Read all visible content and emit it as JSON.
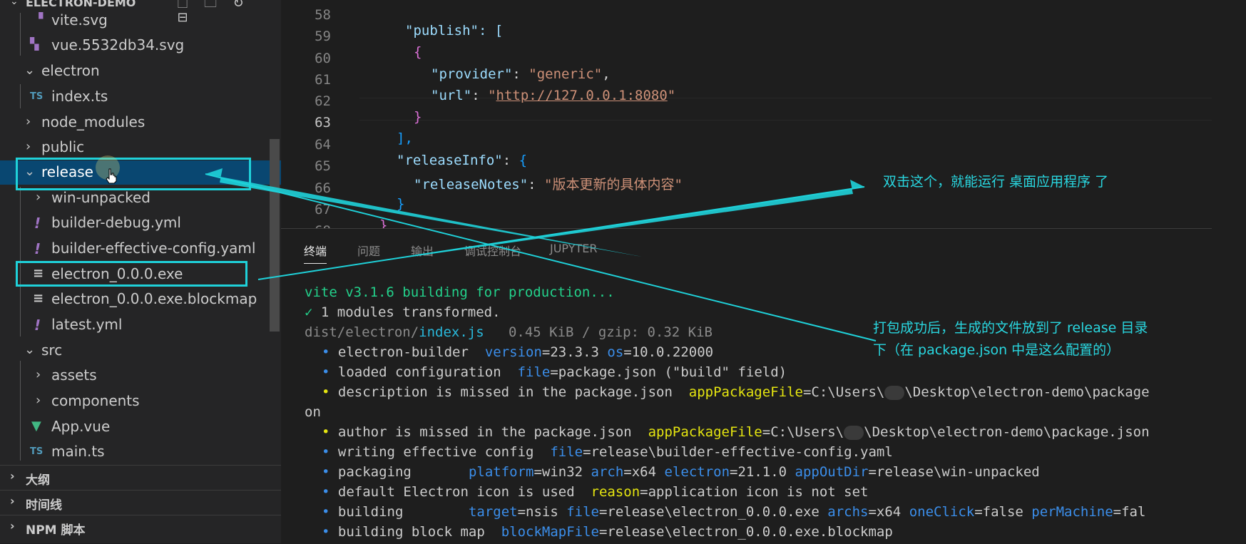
{
  "explorer": {
    "title": "ELECTRON-DEMO",
    "items": [
      {
        "label": "vite.svg",
        "icon": "svg-file-icon",
        "kind": "file"
      },
      {
        "label": "vue.5532db34.svg",
        "icon": "svg-file-icon",
        "kind": "file"
      },
      {
        "label": "electron",
        "icon": "chevron-down-icon",
        "kind": "folder-open"
      },
      {
        "label": "index.ts",
        "icon": "typescript-file-icon",
        "icon_text": "TS",
        "kind": "file"
      },
      {
        "label": "node_modules",
        "icon": "chevron-right-icon",
        "kind": "folder"
      },
      {
        "label": "public",
        "icon": "chevron-right-icon",
        "kind": "folder"
      },
      {
        "label": "release",
        "icon": "chevron-down-icon",
        "kind": "folder-open-selected"
      },
      {
        "label": "win-unpacked",
        "icon": "chevron-right-icon",
        "kind": "folder"
      },
      {
        "label": "builder-debug.yml",
        "icon": "yaml-file-icon",
        "kind": "file"
      },
      {
        "label": "builder-effective-config.yaml",
        "icon": "yaml-file-icon",
        "kind": "file"
      },
      {
        "label": "electron_0.0.0.exe",
        "icon": "exe-file-icon",
        "kind": "file"
      },
      {
        "label": "electron_0.0.0.exe.blockmap",
        "icon": "exe-file-icon",
        "kind": "file"
      },
      {
        "label": "latest.yml",
        "icon": "yaml-file-icon",
        "kind": "file"
      },
      {
        "label": "src",
        "icon": "chevron-down-icon",
        "kind": "folder-open"
      },
      {
        "label": "assets",
        "icon": "chevron-right-icon",
        "kind": "folder"
      },
      {
        "label": "components",
        "icon": "chevron-right-icon",
        "kind": "folder"
      },
      {
        "label": "App.vue",
        "icon": "vue-file-icon",
        "kind": "file"
      },
      {
        "label": "main.ts",
        "icon": "typescript-file-icon",
        "icon_text": "TS",
        "kind": "file"
      }
    ],
    "sections": [
      {
        "label": "大纲"
      },
      {
        "label": "时间线"
      },
      {
        "label": "NPM 脚本"
      }
    ]
  },
  "editor": {
    "active_line": "63",
    "lines": [
      {
        "n": "58",
        "text": "\"publish\": ["
      },
      {
        "n": "59",
        "text": "{"
      },
      {
        "n": "60",
        "key": "\"provider\"",
        "val": "\"generic\""
      },
      {
        "n": "61",
        "key": "\"url\"",
        "q": "\"",
        "url": "http://127.0.0.1:8080"
      },
      {
        "n": "62",
        "text": "}"
      },
      {
        "n": "63",
        "text": "],"
      },
      {
        "n": "64",
        "key": "\"releaseInfo\"",
        "text": "{"
      },
      {
        "n": "65",
        "key": "\"releaseNotes\"",
        "val": "\"版本更新的具体内容\""
      },
      {
        "n": "66",
        "text": "}"
      },
      {
        "n": "67",
        "text": "}"
      },
      {
        "n": "68",
        "text": "}"
      }
    ]
  },
  "panel": {
    "tabs": [
      "终端",
      "问题",
      "输出",
      "调试控制台",
      "JUPYTER"
    ],
    "active_tab": "终端"
  },
  "terminal": {
    "lines": [
      {
        "text": "vite v3.1.6 building for production..."
      },
      {
        "check": "✓",
        "text": " 1 modules transformed."
      },
      {
        "dir": "dist/electron/",
        "file": "index.js",
        "size": "   0.45 KiB / gzip: 0.32 KiB"
      },
      {
        "bullet": "•",
        "text": "electron-builder  ",
        "k1": "version",
        "v1": "=23.3.3 ",
        "k2": "os",
        "v2": "=10.0.22000"
      },
      {
        "bullet": "•",
        "text": "loaded configuration  ",
        "k1": "file",
        "v1": "=package.json (\"build\" field)"
      },
      {
        "bullet": "•",
        "text": "description is missed in the package.json  ",
        "k1": "appPackageFile",
        "v1": "=C:\\Users\\",
        "v2": "\\Desktop\\electron-demo\\package"
      },
      {
        "text": "on"
      },
      {
        "bullet": "•",
        "text": "author is missed in the package.json  ",
        "k1": "appPackageFile",
        "v1": "=C:\\Users\\",
        "v2": "\\Desktop\\electron-demo\\package.json"
      },
      {
        "bullet": "•",
        "text": "writing effective config  ",
        "k1": "file",
        "v1": "=release\\builder-effective-config.yaml"
      },
      {
        "bullet": "•",
        "text": "packaging       ",
        "k1": "platform",
        "v1": "=win32 ",
        "k2": "arch",
        "v2": "=x64 ",
        "k3": "electron",
        "v3": "=21.1.0 ",
        "k4": "appOutDir",
        "v4": "=release\\win-unpacked"
      },
      {
        "bullet": "•",
        "text": "default Electron icon is used  ",
        "k1": "reason",
        "v1": "=application icon is not set"
      },
      {
        "bullet": "•",
        "text": "building        ",
        "k1": "target",
        "v1": "=nsis ",
        "k2": "file",
        "v2": "=release\\electron_0.0.0.exe ",
        "k3": "archs",
        "v3": "=x64 ",
        "k4": "oneClick",
        "v4": "=false ",
        "k5": "perMachine",
        "v5": "=fal"
      },
      {
        "bullet": "•",
        "text": "building block map  ",
        "k1": "blockMapFile",
        "v1": "=release\\electron_0.0.0.exe.blockmap"
      }
    ]
  },
  "annotations": {
    "note1": "双击这个，就能运行 桌面应用程序 了",
    "note2_line1": "打包成功后，生成的文件放到了 release 目录",
    "note2_line2": "下（在 package.json 中是这么配置的）",
    "color": "#1fd1d9"
  }
}
